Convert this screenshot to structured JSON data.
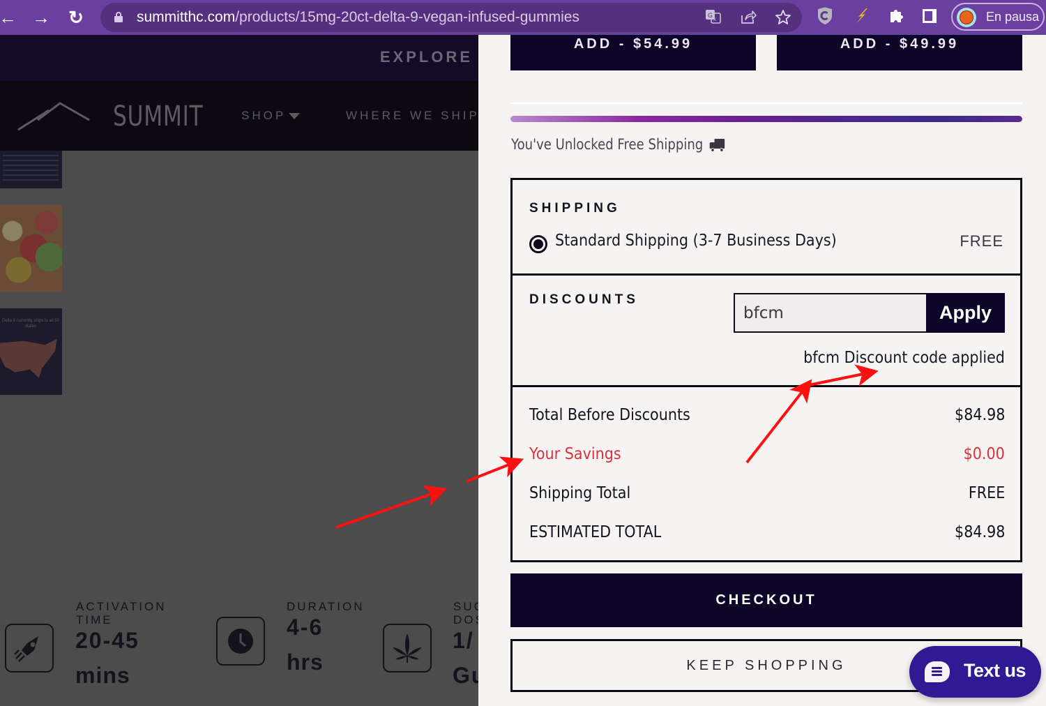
{
  "browser": {
    "url_host": "summitthc.com",
    "url_path": "/products/15mg-20ct-delta-9-vegan-infused-gummies",
    "profile_label": "En pausa",
    "icons": [
      "back-icon",
      "forward-icon",
      "reload-icon",
      "lock-icon",
      "translate-icon",
      "share-icon",
      "bookmark-star-icon",
      "shield-extension-icon",
      "lightning-extension-icon",
      "extensions-puzzle-icon",
      "side-panel-icon",
      "basketball-avatar-icon"
    ]
  },
  "site": {
    "topbar_link": "EXPLORE",
    "logo_text": "SUMMIT",
    "nav": [
      {
        "label": "SHOP"
      },
      {
        "label": "WHERE WE SHIP"
      }
    ],
    "thumb_map_caption": "Delta 9 currently ships to all 50 states",
    "stats": [
      {
        "label_line1": "ACTIVATION",
        "label_line2": "TIME",
        "value_line1": "20-45",
        "value_line2": "mins",
        "icon": "rocket-icon"
      },
      {
        "label_line1": "DURATION",
        "label_line2": "",
        "value_line1": "4-6",
        "value_line2": "hrs",
        "icon": "clock-icon"
      },
      {
        "label_line1": "SUG",
        "label_line2": "DOS",
        "value_line1": "1/",
        "value_line2": "Gu",
        "icon": "cannabis-leaf-icon"
      }
    ]
  },
  "cart": {
    "upsell_buttons": [
      {
        "label": "ADD - $54.99"
      },
      {
        "label": "ADD - $49.99"
      }
    ],
    "free_shipping_progress": 1.0,
    "free_shipping_message": "You've Unlocked Free Shipping",
    "shipping": {
      "title": "SHIPPING",
      "option_label": "Standard Shipping (3-7 Business Days)",
      "option_price": "FREE",
      "selected": true
    },
    "discounts": {
      "title": "DISCOUNTS",
      "code_value": "bfcm",
      "apply_label": "Apply",
      "status_message": "bfcm Discount code applied"
    },
    "totals": [
      {
        "label": "Total Before Discounts",
        "value": "$84.98",
        "highlight": false
      },
      {
        "label": "Your Savings",
        "value": "$0.00",
        "highlight": true
      },
      {
        "label": "Shipping Total",
        "value": "FREE",
        "highlight": false
      },
      {
        "label": "ESTIMATED TOTAL",
        "value": "$84.98",
        "highlight": false
      }
    ],
    "checkout_label": "CHECKOUT",
    "keep_shopping_label": "KEEP SHOPPING"
  },
  "chat_widget": {
    "label": "Text us"
  },
  "colors": {
    "browser_purple": "#6b3fa0",
    "brand_navy": "#0d0527",
    "savings_red": "#d9323c",
    "chat_purple": "#2f1a93",
    "annotation_red": "#ff0000"
  }
}
